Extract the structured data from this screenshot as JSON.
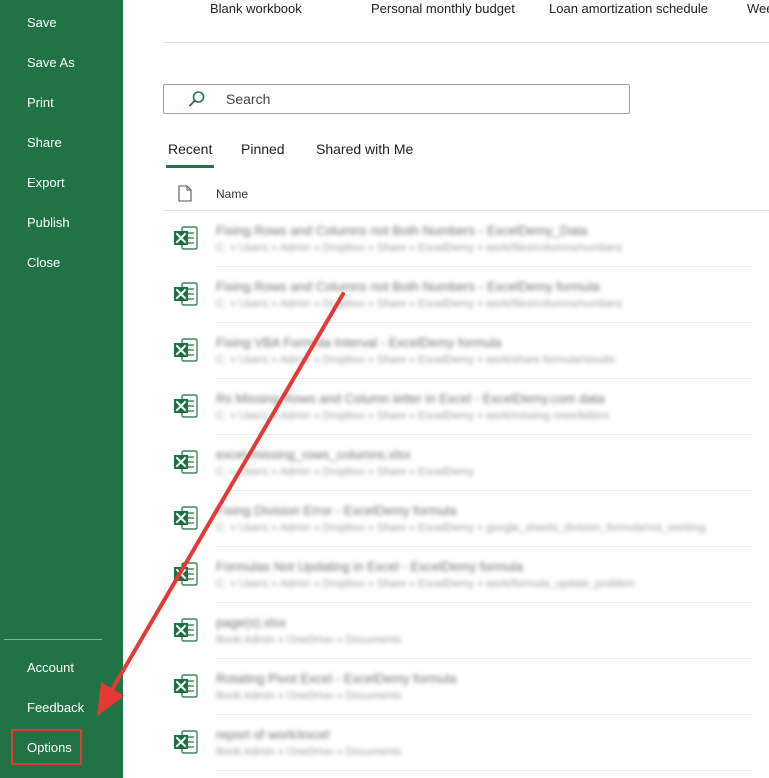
{
  "sidebar": {
    "items": [
      {
        "id": "save",
        "label": "Save"
      },
      {
        "id": "save-as",
        "label": "Save As"
      },
      {
        "id": "print",
        "label": "Print"
      },
      {
        "id": "share",
        "label": "Share"
      },
      {
        "id": "export",
        "label": "Export"
      },
      {
        "id": "publish",
        "label": "Publish"
      },
      {
        "id": "close",
        "label": "Close"
      }
    ],
    "bottom_items": [
      {
        "id": "account",
        "label": "Account"
      },
      {
        "id": "feedback",
        "label": "Feedback"
      },
      {
        "id": "options",
        "label": "Options"
      }
    ],
    "background": "#217346"
  },
  "templates": [
    {
      "label": "Blank workbook"
    },
    {
      "label": "Personal monthly budget"
    },
    {
      "label": "Loan amortization schedule"
    },
    {
      "label": "Wee"
    }
  ],
  "search": {
    "placeholder": "Search"
  },
  "tabs": [
    {
      "label": "Recent",
      "active": true
    },
    {
      "label": "Pinned",
      "active": false
    },
    {
      "label": "Shared with Me",
      "active": false
    }
  ],
  "file_list": {
    "header_name": "Name",
    "files": [
      {
        "name": "Fixing Rows and Columns not Both Numbers - ExcelDemy_Data",
        "path": "C: » Users » Admin » Dropbox » Share » ExcelDemy » work/files/columns/numbers"
      },
      {
        "name": "Fixing Rows and Columns not Both Numbers - ExcelDemy formula",
        "path": "C: » Users » Admin » Dropbox » Share » ExcelDemy » work/files/columns/numbers"
      },
      {
        "name": "Fixing VBA Formula Interval - ExcelDemy formula",
        "path": "C: » Users » Admin » Dropbox » Share » ExcelDemy » work/share formula/results"
      },
      {
        "name": "Rs Missing Rows and Column letter in Excel - ExcelDemy.com data",
        "path": "C: » Users » Admin » Dropbox » Share » ExcelDemy » work/missing rows/letters"
      },
      {
        "name": "excel-missing_rows_columns.xlsx",
        "path": "C: » Users » Admin » Dropbox » Share » ExcelDemy"
      },
      {
        "name": "Fixing Division Error - ExcelDemy formula",
        "path": "C: » Users » Admin » Dropbox » Share » ExcelDemy » google_sheets_division_formula/not_working"
      },
      {
        "name": "Formulas Not Updating in Excel - ExcelDemy formula",
        "path": "C: » Users » Admin » Dropbox » Share » ExcelDemy » work/formula_update_problem"
      },
      {
        "name": "page(s).xlsx",
        "path": "Book Admin » OneDrive » Documents"
      },
      {
        "name": "Rotating Pivot Excel - ExcelDemy formula",
        "path": "Book Admin » OneDrive » Documents"
      },
      {
        "name": "report of work/excel",
        "path": "Book Admin » OneDrive » Documents"
      }
    ]
  },
  "colors": {
    "accent": "#217346",
    "annotation": "#e53935",
    "excel_icon": "#1d6f42"
  }
}
